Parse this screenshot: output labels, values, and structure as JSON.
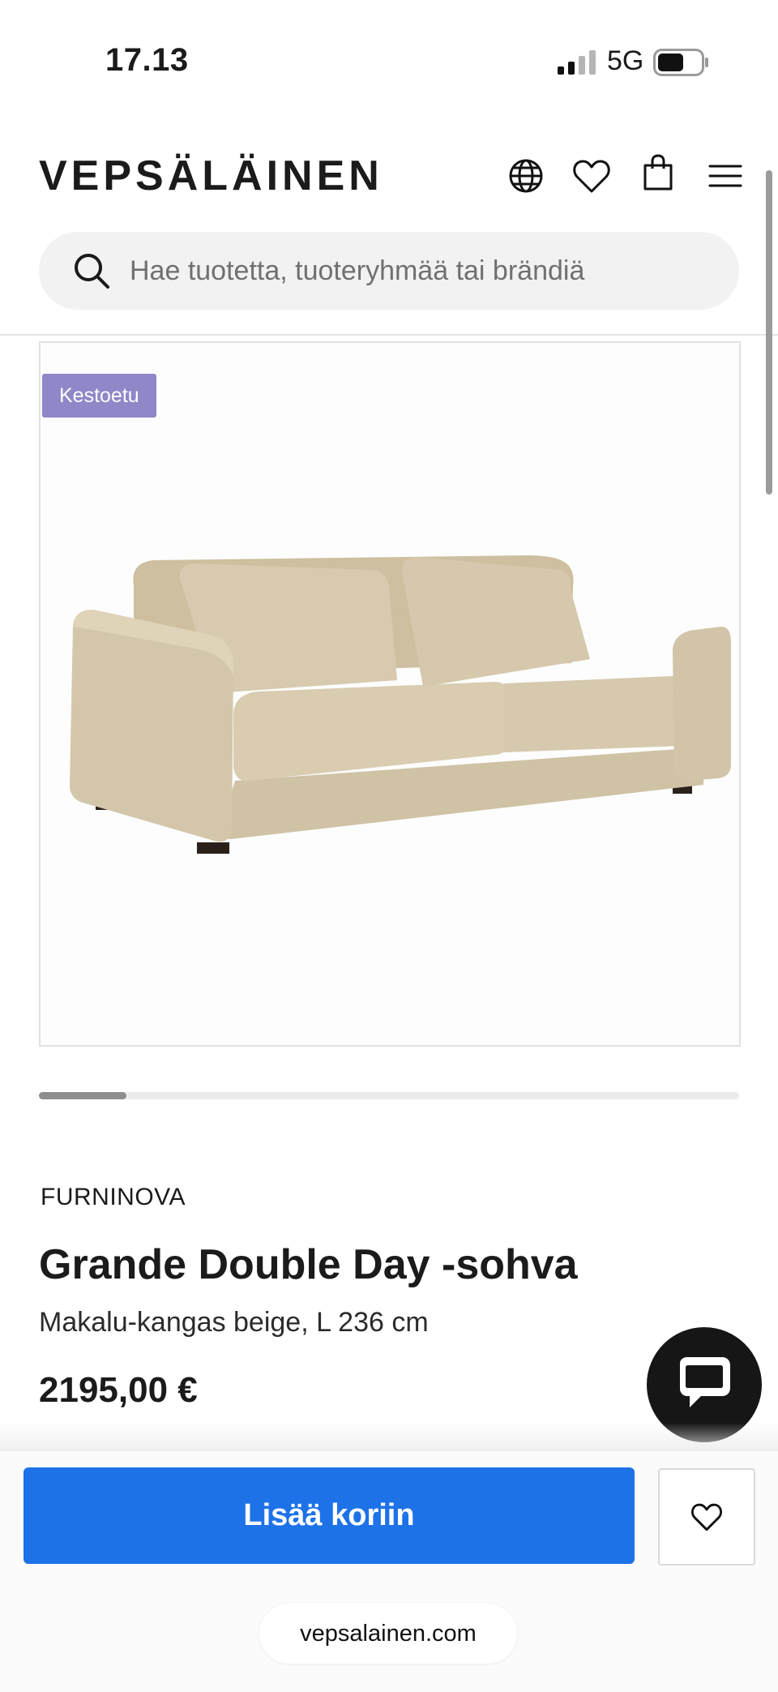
{
  "status_bar": {
    "time": "17.13",
    "network": "5G"
  },
  "header": {
    "logo": "VEPSÄLÄINEN",
    "icons": [
      "globe-icon",
      "heart-icon",
      "bag-icon",
      "menu-icon"
    ]
  },
  "search": {
    "placeholder": "Hae tuotetta, tuoteryhmää tai brändiä"
  },
  "gallery": {
    "badge": "Kestoetu",
    "progress": 0.125
  },
  "product": {
    "brand": "FURNINOVA",
    "title": "Grande Double Day -sohva",
    "variant": "Makalu-kangas beige, L 236 cm",
    "price": "2195,00 €"
  },
  "actions": {
    "add_to_cart": "Lisää koriin"
  },
  "browser": {
    "url": "vepsalainen.com"
  },
  "colors": {
    "accent": "#1d72e8",
    "badge": "#8f87c8",
    "sofa": "#d6c9ad"
  }
}
